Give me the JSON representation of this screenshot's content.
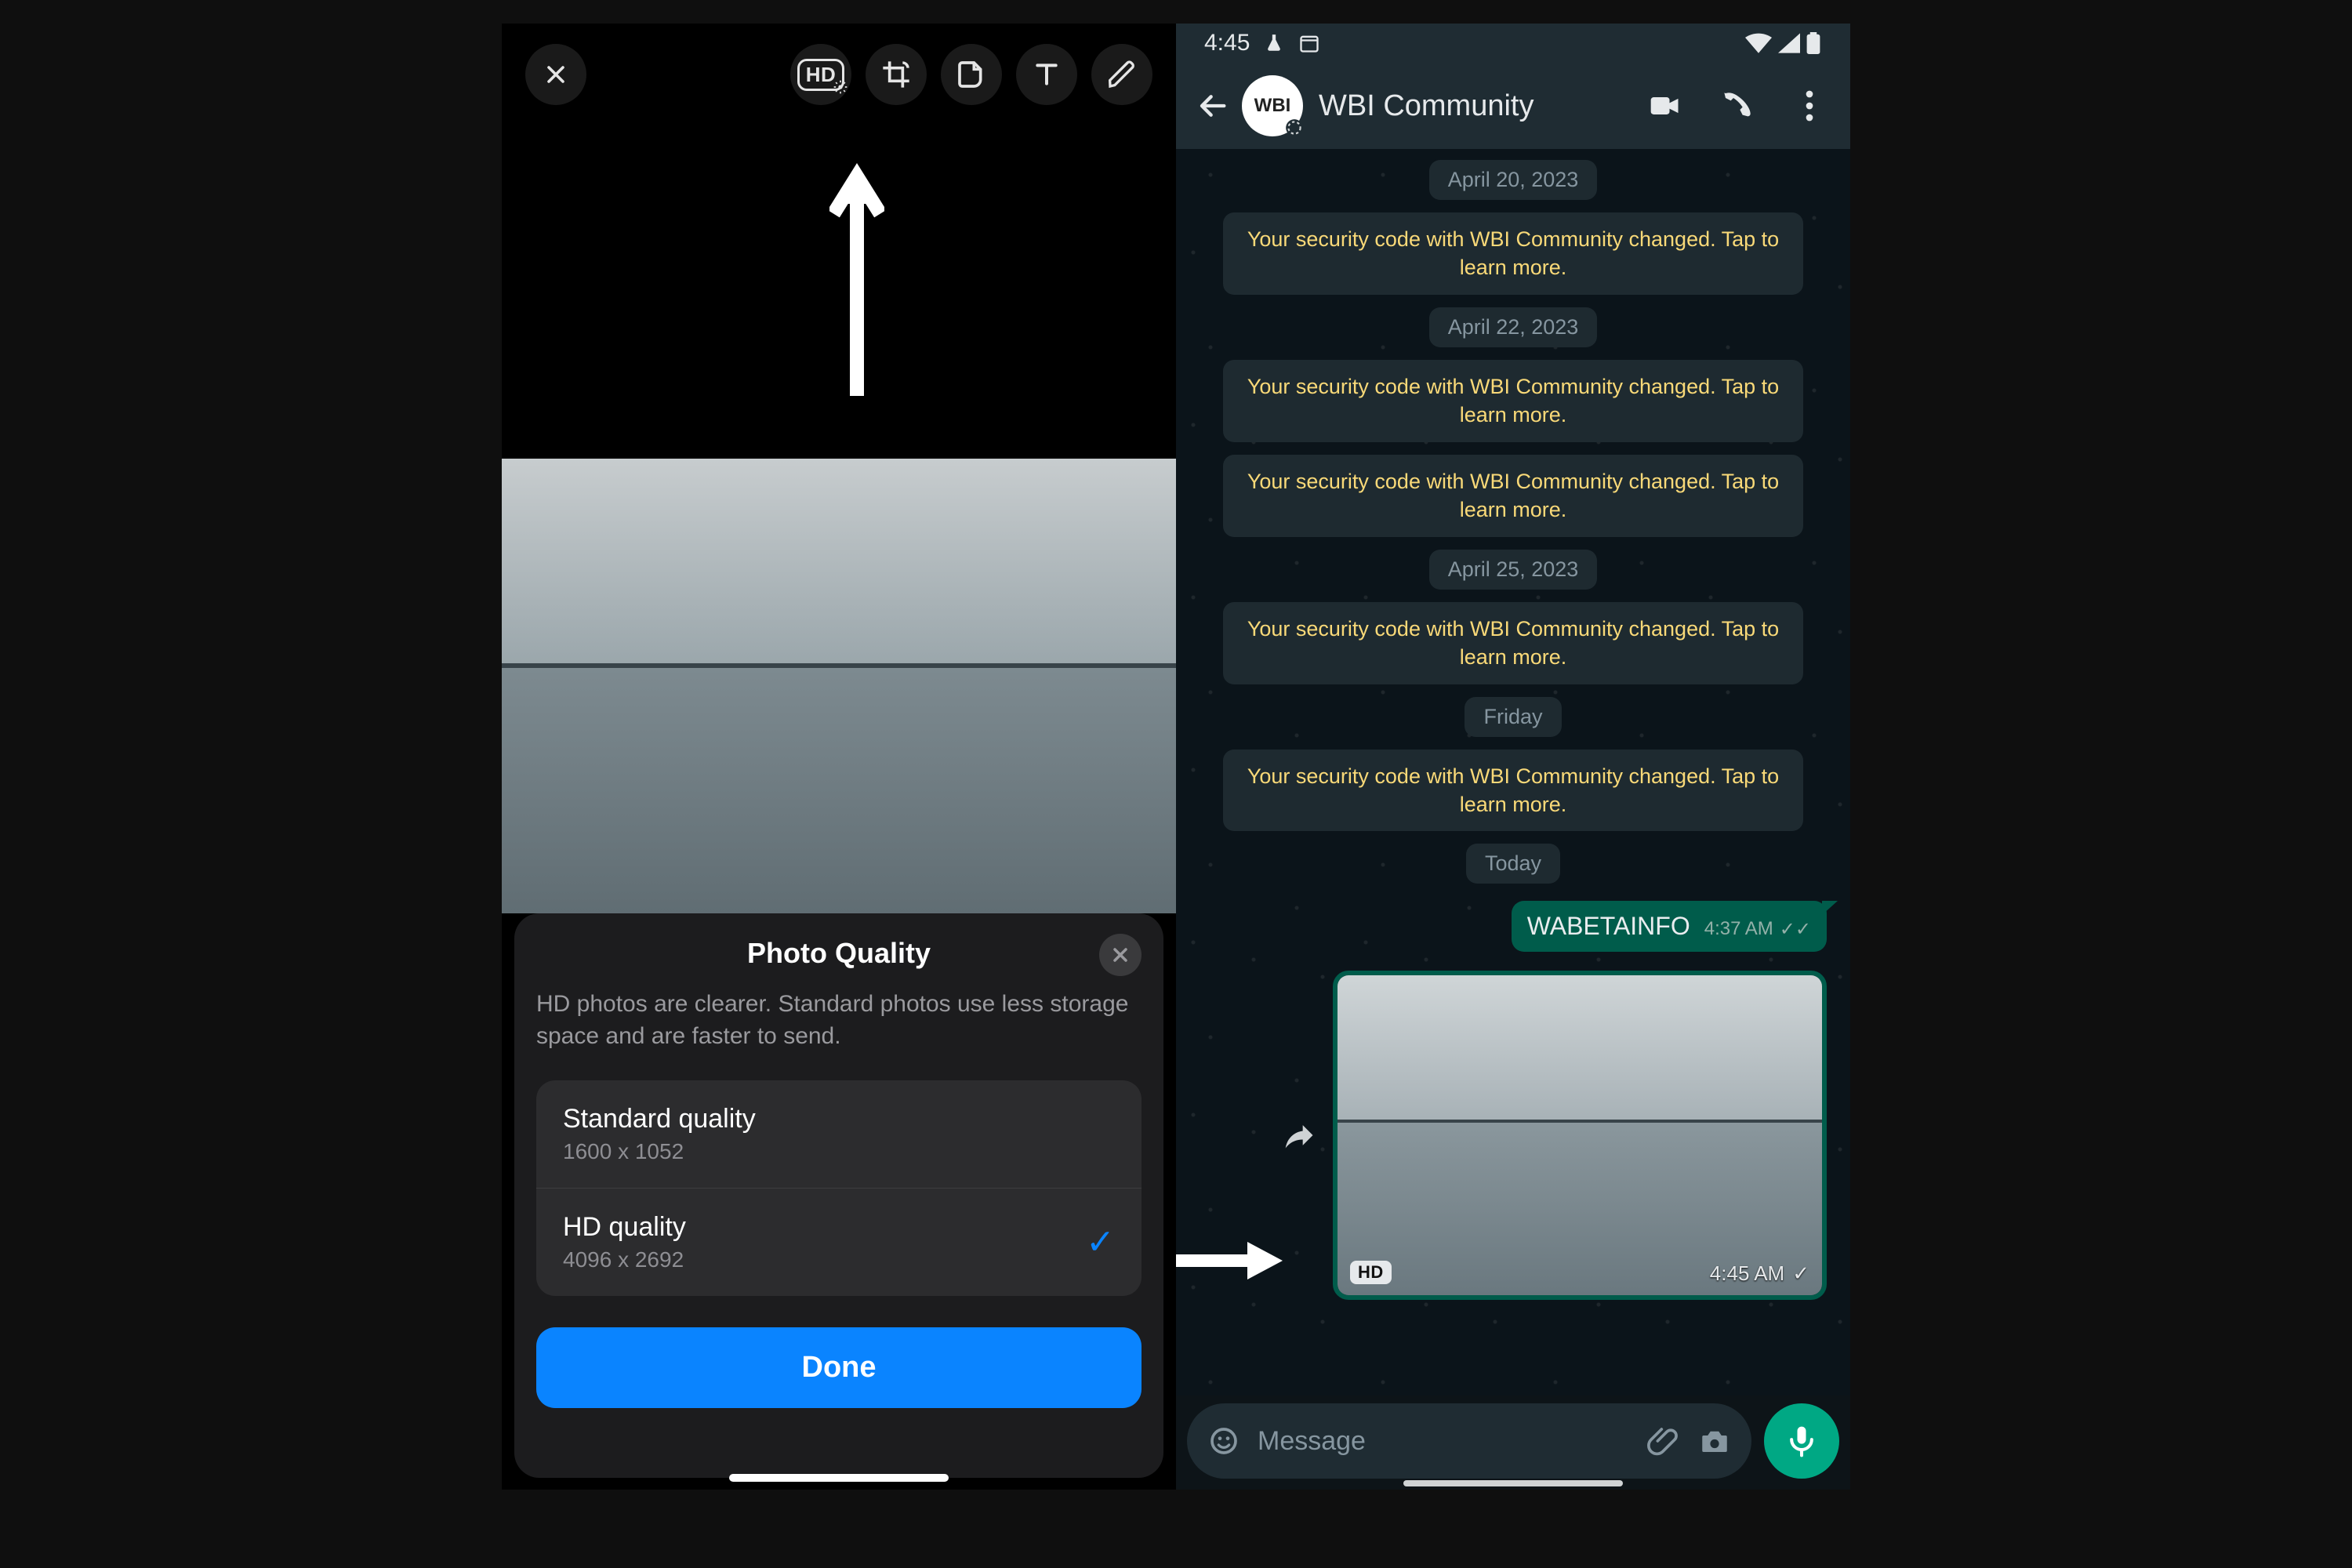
{
  "left": {
    "sheet": {
      "title": "Photo Quality",
      "desc": "HD photos are clearer. Standard photos use less storage space and are faster to send.",
      "options": [
        {
          "label": "Standard quality",
          "dim": "1600 x 1052",
          "selected": false
        },
        {
          "label": "HD quality",
          "dim": "4096 x 2692",
          "selected": true
        }
      ],
      "done": "Done"
    },
    "toolbar_icons": [
      "close",
      "hd",
      "crop",
      "sticker",
      "text",
      "draw"
    ]
  },
  "right": {
    "status": {
      "time": "4:45"
    },
    "header": {
      "title": "WBI Community",
      "avatar_text": "WBI"
    },
    "timeline": [
      {
        "type": "date",
        "text": "April 20, 2023"
      },
      {
        "type": "sys",
        "text": "Your security code with WBI Community changed. Tap to learn more."
      },
      {
        "type": "date",
        "text": "April 22, 2023"
      },
      {
        "type": "sys",
        "text": "Your security code with WBI Community changed. Tap to learn more."
      },
      {
        "type": "sys",
        "text": "Your security code with WBI Community changed. Tap to learn more."
      },
      {
        "type": "date",
        "text": "April 25, 2023"
      },
      {
        "type": "sys",
        "text": "Your security code with WBI Community changed. Tap to learn more."
      },
      {
        "type": "date",
        "text": "Friday"
      },
      {
        "type": "sys",
        "text": "Your security code with WBI Community changed. Tap to learn more."
      },
      {
        "type": "date",
        "text": "Today"
      }
    ],
    "outgoing_text": {
      "body": "WABETAINFO",
      "time": "4:37 AM"
    },
    "outgoing_image": {
      "hd_badge": "HD",
      "time": "4:45 AM"
    },
    "input": {
      "placeholder": "Message"
    }
  },
  "watermark": "WABETAINFO"
}
